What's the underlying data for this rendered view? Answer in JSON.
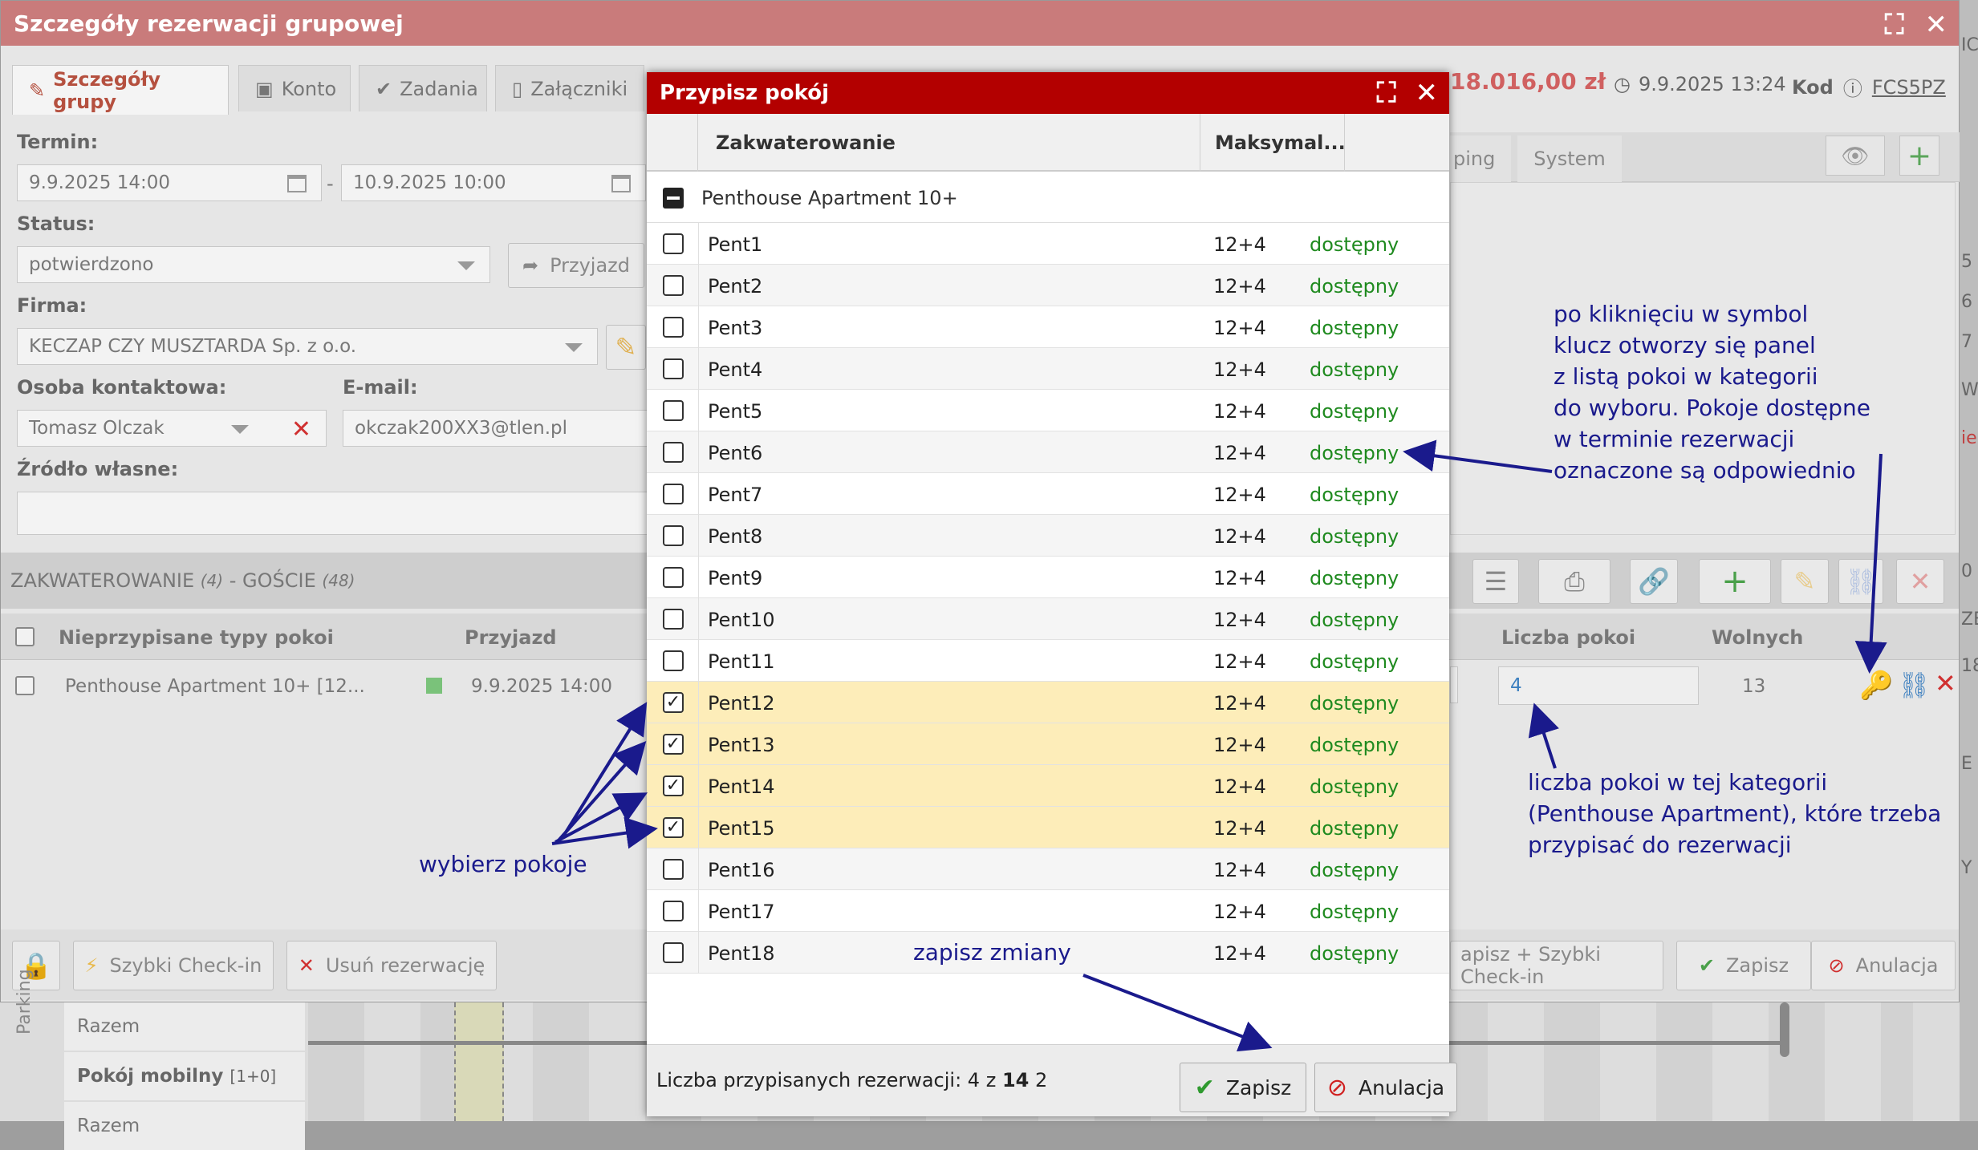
{
  "window": {
    "title": "Szczegóły rezerwacji grupowej",
    "price": "18.016,00 zł",
    "datetime": "9.9.2025 13:24",
    "code_label": "Kod",
    "code": "FCS5PZ"
  },
  "tabs": [
    {
      "label": "Szczegóły grupy"
    },
    {
      "label": "Konto"
    },
    {
      "label": "Zadania"
    },
    {
      "label": "Załączniki"
    }
  ],
  "right_tabs": [
    "ping",
    "System"
  ],
  "form": {
    "termin_label": "Termin:",
    "date_from": "9.9.2025 14:00",
    "date_sep": "-",
    "date_to": "10.9.2025 10:00",
    "status_label": "Status:",
    "status_value": "potwierdzono",
    "arrival_button": "Przyjazd",
    "firma_label": "Firma:",
    "firma_value": "KECZAP CZY MUSZTARDA Sp. z o.o.",
    "contact_label": "Osoba kontaktowa:",
    "contact_value": "Tomasz Olczak",
    "email_label": "E-mail:",
    "email_value": "okczak200XX3@tlen.pl",
    "source_label": "Źródło własne:"
  },
  "section": {
    "title": "ZAKWATEROWANIE",
    "count": "(4)",
    "guests_sep": "- GOŚCIE",
    "guests": "(48)"
  },
  "grid": {
    "headers": [
      "Nieprzypisane typy pokoi",
      "Przyjazd",
      "Liczba pokoi",
      "Wolnych"
    ],
    "row": {
      "type": "Penthouse Apartment 10+ [12...",
      "arrival": "9.9.2025 14:00",
      "rooms": "4",
      "free": "13"
    }
  },
  "bottom_buttons": {
    "quick_checkin": "Szybki Check-in",
    "delete": "Usuń rezerwację",
    "save_checkin": "apisz + Szybki Check-in",
    "save": "Zapisz",
    "cancel": "Anulacja"
  },
  "timeline": {
    "parking_label": "Parking",
    "rows": [
      "Razem",
      "Pokój mobilny",
      "Razem"
    ],
    "mobile_suffix": "[1+0]"
  },
  "modal": {
    "title": "Przypisz pokój",
    "col_accommodation": "Zakwaterowanie",
    "col_max": "Maksymal...",
    "group_name": "Penthouse Apartment 10+",
    "rooms": [
      {
        "name": "Pent1",
        "capacity": "12+4",
        "status": "dostępny",
        "checked": false
      },
      {
        "name": "Pent2",
        "capacity": "12+4",
        "status": "dostępny",
        "checked": false
      },
      {
        "name": "Pent3",
        "capacity": "12+4",
        "status": "dostępny",
        "checked": false
      },
      {
        "name": "Pent4",
        "capacity": "12+4",
        "status": "dostępny",
        "checked": false
      },
      {
        "name": "Pent5",
        "capacity": "12+4",
        "status": "dostępny",
        "checked": false
      },
      {
        "name": "Pent6",
        "capacity": "12+4",
        "status": "dostępny",
        "checked": false
      },
      {
        "name": "Pent7",
        "capacity": "12+4",
        "status": "dostępny",
        "checked": false
      },
      {
        "name": "Pent8",
        "capacity": "12+4",
        "status": "dostępny",
        "checked": false
      },
      {
        "name": "Pent9",
        "capacity": "12+4",
        "status": "dostępny",
        "checked": false
      },
      {
        "name": "Pent10",
        "capacity": "12+4",
        "status": "dostępny",
        "checked": false
      },
      {
        "name": "Pent11",
        "capacity": "12+4",
        "status": "dostępny",
        "checked": false
      },
      {
        "name": "Pent12",
        "capacity": "12+4",
        "status": "dostępny",
        "checked": true
      },
      {
        "name": "Pent13",
        "capacity": "12+4",
        "status": "dostępny",
        "checked": true
      },
      {
        "name": "Pent14",
        "capacity": "12+4",
        "status": "dostępny",
        "checked": true
      },
      {
        "name": "Pent15",
        "capacity": "12+4",
        "status": "dostępny",
        "checked": true
      },
      {
        "name": "Pent16",
        "capacity": "12+4",
        "status": "dostępny",
        "checked": false
      },
      {
        "name": "Pent17",
        "capacity": "12+4",
        "status": "dostępny",
        "checked": false
      },
      {
        "name": "Pent18",
        "capacity": "12+4",
        "status": "dostępny",
        "checked": false
      }
    ],
    "footer_label": "Liczba przypisanych rezerwacji:",
    "footer_assigned": "4",
    "footer_of": "z",
    "footer_total": "14",
    "footer_extra": "2",
    "save_label": "Zapisz",
    "cancel_label": "Anulacja"
  },
  "annotations": {
    "key_note": [
      "po kliknięciu w symbol",
      "klucz otworzy się panel",
      "z listą pokoi w kategorii",
      "do wyboru. Pokoje dostępne",
      "w terminie rezerwacji",
      "oznaczone są odpowiednio"
    ],
    "count_note": [
      "liczba pokoi w tej kategorii",
      "(Penthouse Apartment), które trzeba",
      "przypisać do rezerwacji"
    ],
    "select_note": "wybierz pokoje",
    "save_note": "zapisz zmiany"
  },
  "right_strip_glyphs": [
    "IC",
    "5",
    "6",
    "7",
    "W",
    "ie",
    "0",
    "ZE",
    "18",
    "E",
    "Y"
  ],
  "colors": {
    "modal_header": "#b30000",
    "window_title": "#c97b7b",
    "available": "#1f8a1f",
    "selected_row": "#fdedb9",
    "annotation": "#1a1a8c",
    "accent": "#b5503f"
  }
}
